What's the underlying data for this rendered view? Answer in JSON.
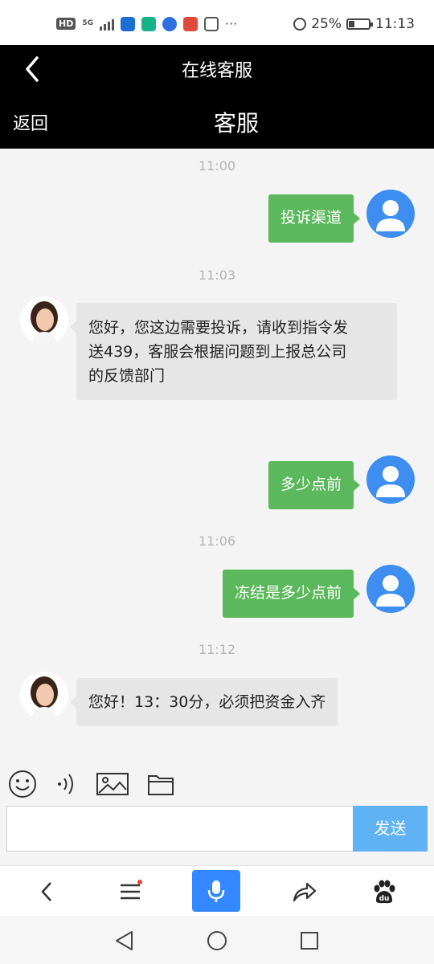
{
  "status_bar": {
    "network_hd": "HD",
    "network_5g": "5G",
    "more": "···",
    "battery": "25%",
    "time": "11:13"
  },
  "header": {
    "title": "在线客服",
    "back_label": "返回",
    "subtitle": "客服"
  },
  "chat": {
    "messages": [
      {
        "time": "11:00",
        "from": "user",
        "text": "投诉渠道"
      },
      {
        "time": "11:03",
        "from": "agent",
        "lines": [
          "您好，您这边需要投诉，请收到指令发",
          "送439，客服会根据问题到上报总公司",
          "的反馈部门"
        ]
      },
      {
        "from": "user",
        "text": "多少点前"
      },
      {
        "time": "11:06",
        "from": "user",
        "text": "冻结是多少点前"
      },
      {
        "time": "11:12",
        "from": "agent",
        "text": "您好！13：30分，必须把资金入齐"
      }
    ]
  },
  "composer": {
    "input_value": "",
    "send_label": "发送",
    "tools": [
      "emoji-icon",
      "voice-icon",
      "image-icon",
      "folder-icon"
    ]
  },
  "browser_bar": {
    "items": [
      "back-icon",
      "menu-icon",
      "microphone-icon",
      "share-icon",
      "baidu-paw-icon"
    ]
  },
  "system_nav": {
    "items": [
      "triangle-back-icon",
      "circle-home-icon",
      "square-recents-icon"
    ]
  },
  "colors": {
    "user_bubble": "#5cb85c",
    "agent_bubble": "#e6e6e6",
    "send_button": "#5fb3f5",
    "mic_button": "#3388ff",
    "header_bg": "#000000"
  }
}
